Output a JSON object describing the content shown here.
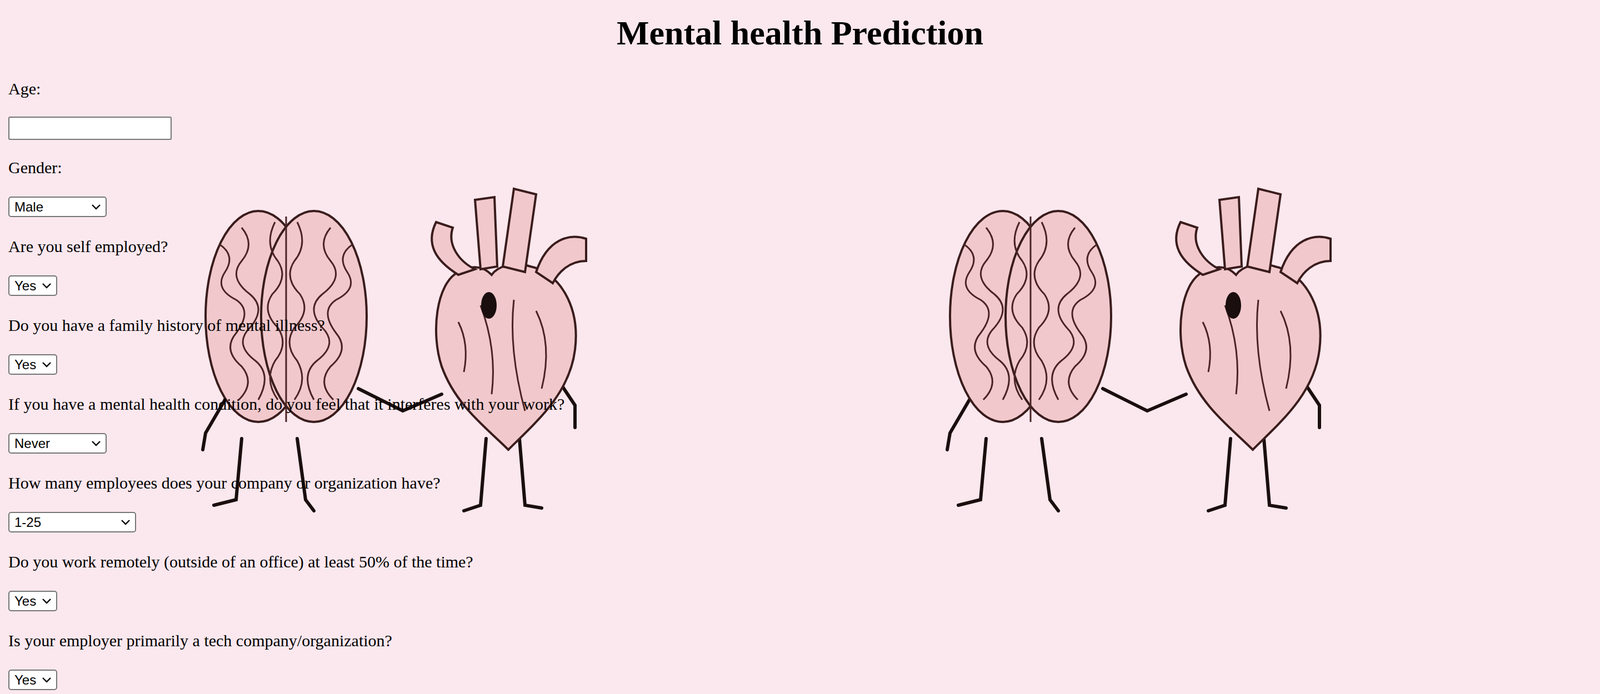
{
  "title": "Mental health Prediction",
  "fields": [
    {
      "label": "Age:",
      "kind": "text",
      "value": ""
    },
    {
      "label": "Gender:",
      "kind": "select",
      "value": "Male"
    },
    {
      "label": "Are you self employed?",
      "kind": "select",
      "value": "Yes"
    },
    {
      "label": "Do you have a family history of mental illness?",
      "kind": "select",
      "value": "Yes"
    },
    {
      "label": "If you have a mental health condition, do you feel that it interferes with your work?",
      "kind": "select",
      "value": "Never"
    },
    {
      "label": "How many employees does your company or organization have?",
      "kind": "select",
      "value": "1-25"
    },
    {
      "label": "Do you work remotely (outside of an office) at least 50% of the time?",
      "kind": "select",
      "value": "Yes"
    },
    {
      "label": "Is your employer primarily a tech company/organization?",
      "kind": "select",
      "value": "Yes"
    }
  ]
}
